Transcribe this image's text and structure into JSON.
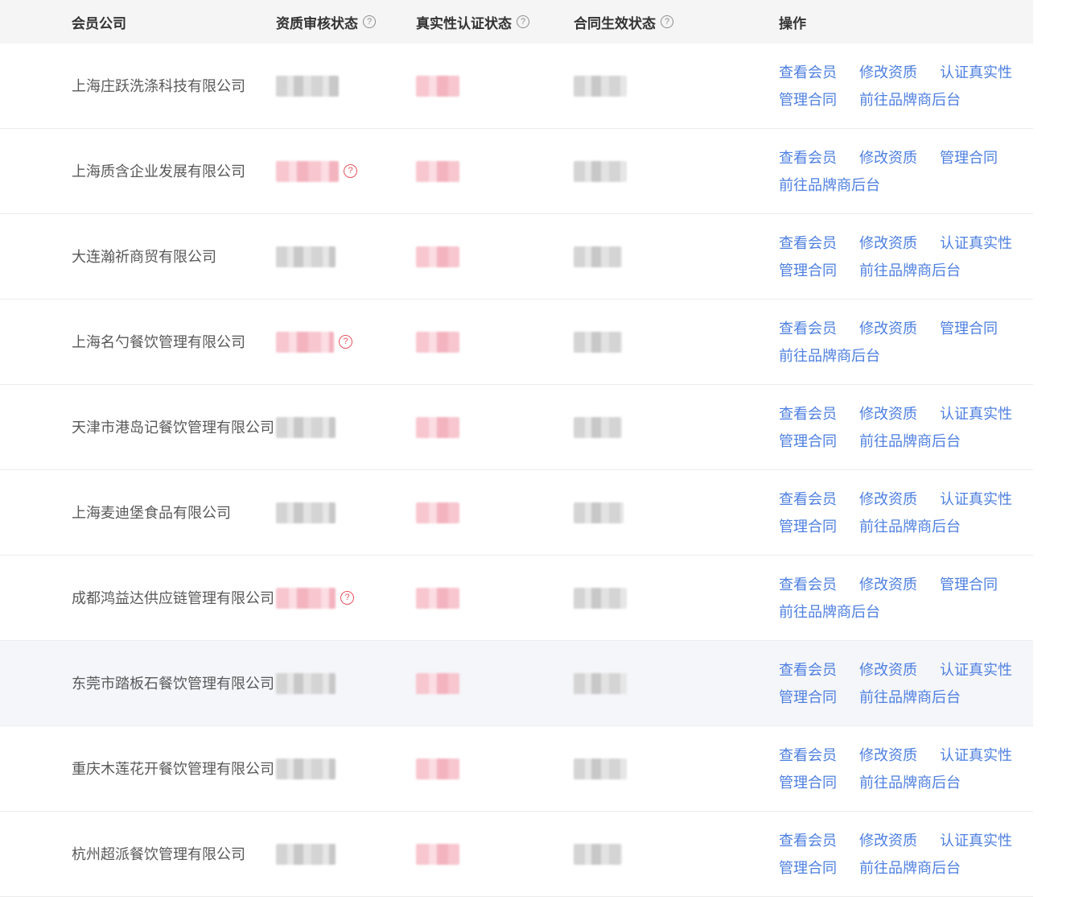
{
  "header": {
    "company": "会员公司",
    "qualification": "资质审核状态",
    "authenticity": "真实性认证状态",
    "contract": "合同生效状态",
    "operations": "操作",
    "help_icon": "?"
  },
  "rows": [
    {
      "company": "上海庄跃洗涤科技有限公司",
      "qual_color": "gray",
      "qual_warn": false,
      "ops": [
        "查看会员",
        "修改资质",
        "认证真实性",
        "管理合同",
        "前往品牌商后台"
      ]
    },
    {
      "company": "上海质含企业发展有限公司",
      "qual_color": "pink",
      "qual_warn": true,
      "ops": [
        "查看会员",
        "修改资质",
        "管理合同",
        "前往品牌商后台"
      ]
    },
    {
      "company": "大连瀚祈商贸有限公司",
      "qual_color": "gray",
      "qual_warn": false,
      "ops": [
        "查看会员",
        "修改资质",
        "认证真实性",
        "管理合同",
        "前往品牌商后台"
      ]
    },
    {
      "company": "上海名勺餐饮管理有限公司",
      "qual_color": "pink",
      "qual_warn": true,
      "ops": [
        "查看会员",
        "修改资质",
        "管理合同",
        "前往品牌商后台"
      ]
    },
    {
      "company": "天津市港岛记餐饮管理有限公司",
      "qual_color": "gray",
      "qual_warn": false,
      "ops": [
        "查看会员",
        "修改资质",
        "认证真实性",
        "管理合同",
        "前往品牌商后台"
      ]
    },
    {
      "company": "上海麦迪堡食品有限公司",
      "qual_color": "gray",
      "qual_warn": false,
      "ops": [
        "查看会员",
        "修改资质",
        "认证真实性",
        "管理合同",
        "前往品牌商后台"
      ]
    },
    {
      "company": "成都鸿益达供应链管理有限公司",
      "qual_color": "pink",
      "qual_warn": true,
      "ops": [
        "查看会员",
        "修改资质",
        "管理合同",
        "前往品牌商后台"
      ]
    },
    {
      "company": "东莞市踏板石餐饮管理有限公司",
      "qual_color": "gray",
      "qual_warn": false,
      "ops": [
        "查看会员",
        "修改资质",
        "认证真实性",
        "管理合同",
        "前往品牌商后台"
      ]
    },
    {
      "company": "重庆木莲花开餐饮管理有限公司",
      "qual_color": "gray",
      "qual_warn": false,
      "ops": [
        "查看会员",
        "修改资质",
        "认证真实性",
        "管理合同",
        "前往品牌商后台"
      ]
    },
    {
      "company": "杭州超派餐饮管理有限公司",
      "qual_color": "gray",
      "qual_warn": false,
      "ops": [
        "查看会员",
        "修改资质",
        "认证真实性",
        "管理合同",
        "前往品牌商后台"
      ]
    }
  ],
  "highlighted_row": 7,
  "colors": {
    "link": "#4d7fe0",
    "warn": "#e5535f",
    "header_bg": "#f5f5f5",
    "hover_bg": "#f5f6fa"
  }
}
